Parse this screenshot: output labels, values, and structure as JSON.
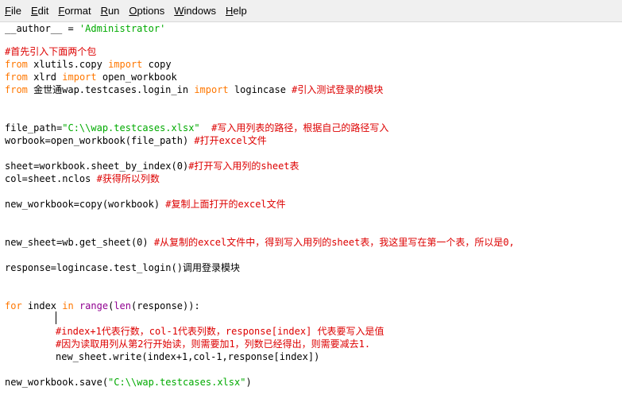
{
  "menu": {
    "items": [
      {
        "accel": "F",
        "rest": "ile"
      },
      {
        "accel": "E",
        "rest": "dit"
      },
      {
        "accel": "",
        "rest": "Format",
        "pre": "F",
        "post": "ormat"
      },
      {
        "accel": "R",
        "rest": "un"
      },
      {
        "accel": "O",
        "rest": "ptions"
      },
      {
        "accel": "W",
        "rest": "indows"
      },
      {
        "accel": "H",
        "rest": "elp"
      }
    ]
  },
  "code": {
    "l1": {
      "a": "__author__ = ",
      "b": "'Administrator'"
    },
    "l2": {
      "a": "#首先引入下面两个包"
    },
    "l3": {
      "a": "from",
      "b": " xlutils.copy ",
      "c": "import",
      "d": " copy"
    },
    "l4": {
      "a": "from",
      "b": " xlrd ",
      "c": "import",
      "d": " open_workbook"
    },
    "l5": {
      "a": "from",
      "b": " 金世通wap.testcases.login_in ",
      "c": "import",
      "d": " logincase ",
      "e": "#引入测试登录的模块"
    },
    "l6": {
      "a": "file_path=",
      "b": "\"C:\\\\wap.testcases.xlsx\"",
      "c": "  #写入用列表的路径，根据自己的路径写入"
    },
    "l7": {
      "a": "worbook=open_workbook(file_path) ",
      "b": "#打开excel文件"
    },
    "l8": {
      "a": "sheet=workbook.sheet_by_index(0)",
      "b": "#打开写入用列的sheet表"
    },
    "l9": {
      "a": "col=sheet.nclos ",
      "b": "#获得所以列数"
    },
    "l10": {
      "a": "new_workbook=copy(workbook) ",
      "b": "#复制上面打开的excel文件"
    },
    "l11": {
      "a": "new_sheet=wb.get_sheet(0) ",
      "b": "#从复制的excel文件中，得到写入用列的sheet表，我这里写在第一个表，所以是0,"
    },
    "l12": {
      "a": "response=logincase.test_login()调用登录模块"
    },
    "l13": {
      "a": "for",
      "b": " index ",
      "c": "in",
      "d": " ",
      "e": "range",
      "f": "(",
      "g": "len",
      "h": "(response)):"
    },
    "l14": {
      "a": "#index+1代表行数，col-1代表列数，response[index] 代表要写入是值"
    },
    "l15": {
      "a": "#因为读取用列从第2行开始读，则需要加1，列数已经得出，则需要减去1."
    },
    "l16": {
      "a": "new_sheet.write(index+1,col-1,response[index])"
    },
    "l17": {
      "a": "new_workbook.save(",
      "b": "\"C:\\\\wap.testcases.xlsx\"",
      "c": ")"
    }
  },
  "colors": {
    "keyword": "#ff7700",
    "builtin": "#900090",
    "string": "#00aa00",
    "comment": "#dd0000"
  }
}
